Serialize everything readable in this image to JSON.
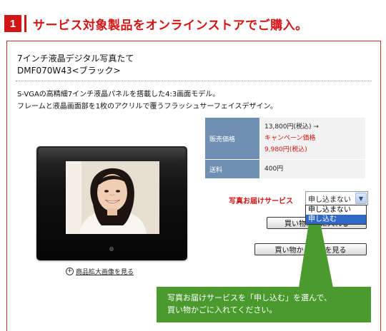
{
  "header": {
    "step": "1",
    "title": "サービス対象製品をオンラインストアでご購入。"
  },
  "product": {
    "name_line1": "7インチ液晶デジタル写真たて",
    "name_line2": "DMF070W43<ブラック>",
    "desc_line1": "S-VGAの高精細7インチ液晶パネルを搭載した4:3画面モデル。",
    "desc_line2": "フレームと液晶画面部を1枚のアクリルで覆うフラッシュサーフェイスデザイン。"
  },
  "price_table": {
    "price_label": "販売価格",
    "regular_price": "13,800円(税込) →",
    "campaign_label": "キャンペーン価格",
    "campaign_price": "9,980円(税込)",
    "shipping_label": "送料",
    "shipping_value": "400円"
  },
  "service": {
    "label": "写真お届けサービス",
    "selected": "申し込まない",
    "options": [
      "申し込まない",
      "申し込む"
    ],
    "highlighted_option": "申し込む"
  },
  "buttons": {
    "add_to_cart": "買い物かごに入れる",
    "view_cart": "買い物かごの中を見る"
  },
  "zoom_link": "商品拡大画像を見る",
  "callout": {
    "line1": "写真お届けサービスを「申し込む」を選んで、",
    "line2": "買い物かごに入れてください。"
  },
  "colors": {
    "accent_red": "#d21616",
    "table_label_blue": "#6f8fb3",
    "callout_green": "#4a9a2e",
    "select_highlight": "#3169c6"
  }
}
